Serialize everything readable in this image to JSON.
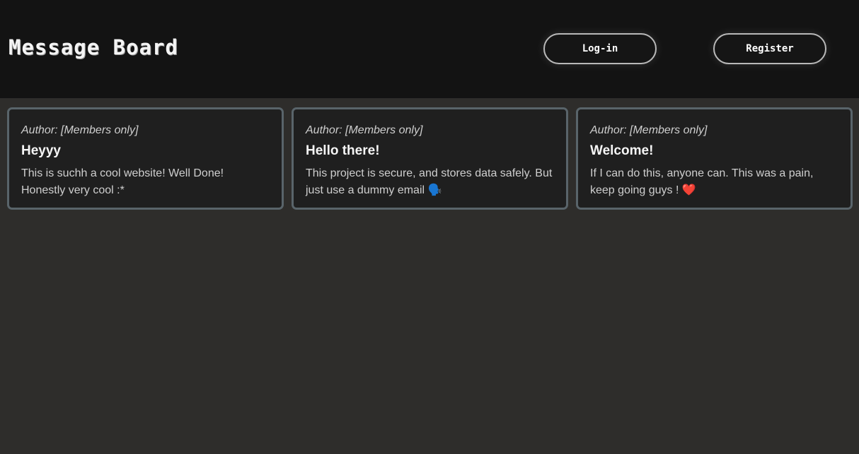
{
  "header": {
    "title": "Message Board",
    "login_label": "Log-in",
    "register_label": "Register"
  },
  "posts": [
    {
      "author": "Author: [Members only]",
      "title": "Heyyy",
      "body": "This is suchh a cool website! Well Done! Honestly very cool :*"
    },
    {
      "author": "Author: [Members only]",
      "title": "Hello there!",
      "body": "This project is secure, and stores data safely. But just use a dummy email 🗣️"
    },
    {
      "author": "Author: [Members only]",
      "title": "Welcome!",
      "body": "If I can do this, anyone can. This was a pain, keep going guys ! ❤️"
    }
  ],
  "colors": {
    "header_bg": "#131313",
    "page_bg": "#2e2d2b",
    "card_bg": "#1f1f1f",
    "card_border": "#59646a"
  }
}
